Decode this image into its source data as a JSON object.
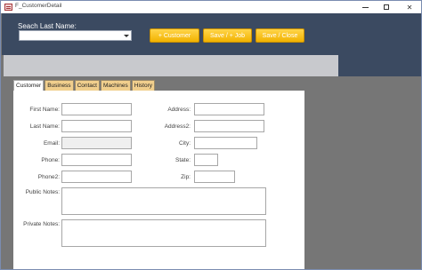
{
  "window": {
    "title": "F_CustomerDetail",
    "icon": "form-icon",
    "controls": [
      "minimize",
      "maximize",
      "close"
    ],
    "close_glyph": "✕"
  },
  "search": {
    "label": "Seach Last Name:",
    "value": ""
  },
  "toolbar": {
    "customer_label": "+ Customer",
    "save_job_label": "Save / + Job",
    "save_close_label": "Save / Close",
    "button_color": "#f2b200"
  },
  "tabs": [
    {
      "label": "Customer",
      "active": true
    },
    {
      "label": "Business",
      "active": false
    },
    {
      "label": "Contact",
      "active": false
    },
    {
      "label": "Machines",
      "active": false
    },
    {
      "label": "History",
      "active": false
    }
  ],
  "form": {
    "first_name_label": "First Name:",
    "last_name_label": "Last Name:",
    "email_label": "Email:",
    "phone_label": "Phone:",
    "phone2_label": "Phone2:",
    "public_notes_label": "Public Notes:",
    "private_notes_label": "Private Notes:",
    "address_label": "Address:",
    "address2_label": "Address2:",
    "city_label": "City:",
    "state_label": "State:",
    "zip_label": "Zip:"
  },
  "colors": {
    "header": "#3b4a61",
    "background": "#767676",
    "tab_inactive": "#f1cf8d"
  }
}
